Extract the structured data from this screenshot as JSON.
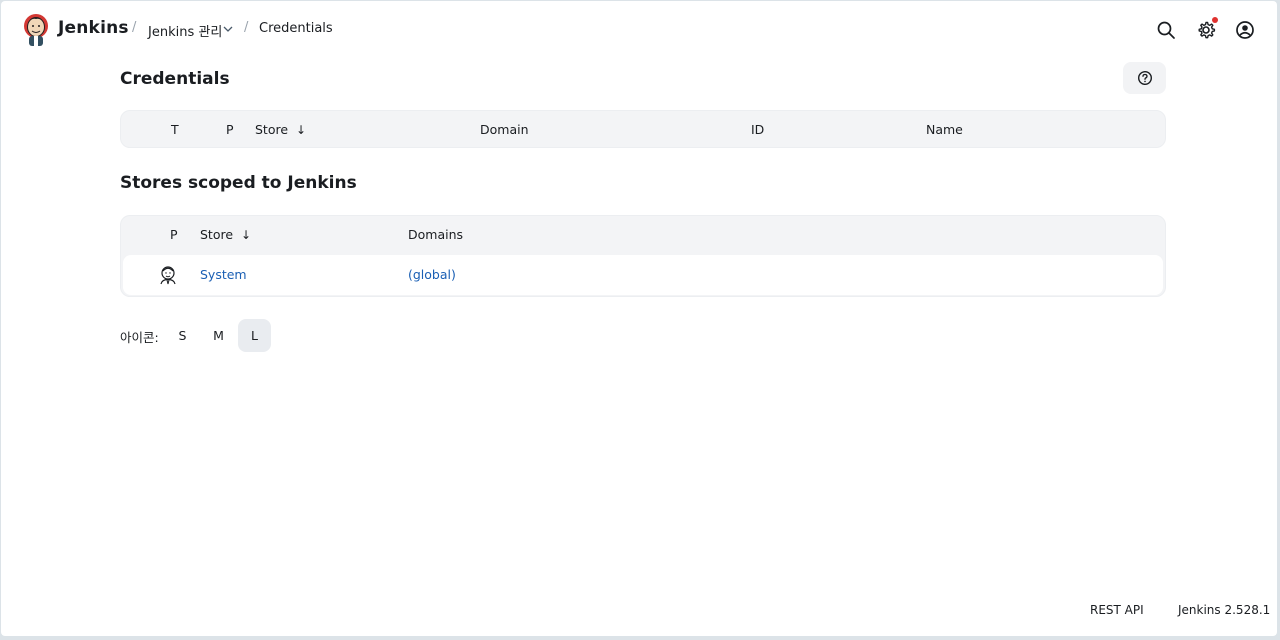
{
  "header": {
    "brand": "Jenkins",
    "separator": "/",
    "breadcrumbs": [
      {
        "label": "Jenkins 관리"
      },
      {
        "label": "Credentials"
      }
    ],
    "icons": [
      "search-icon",
      "gear-icon",
      "account-icon"
    ],
    "notification_color": "#e0312f"
  },
  "credentials": {
    "title": "Credentials",
    "help_icon": "help-circle-icon",
    "columns": [
      "T",
      "P",
      "Store",
      "Domain",
      "ID",
      "Name"
    ],
    "sort_indicator": "↓"
  },
  "stores": {
    "title": "Stores scoped to Jenkins",
    "columns": [
      "P",
      "Store",
      "Domains"
    ],
    "sort_indicator": "↓",
    "rows": [
      {
        "icon": "jenkins-butler-icon",
        "store": "System",
        "domains": "(global)"
      }
    ]
  },
  "icon_size": {
    "label": "아이콘:",
    "options": [
      "S",
      "M",
      "L"
    ],
    "selected": "L"
  },
  "footer": {
    "rest_api": "REST API",
    "version": "Jenkins 2.528.1"
  },
  "colors": {
    "link": "#1a5fb4",
    "table_header_bg": "#f3f4f6"
  }
}
